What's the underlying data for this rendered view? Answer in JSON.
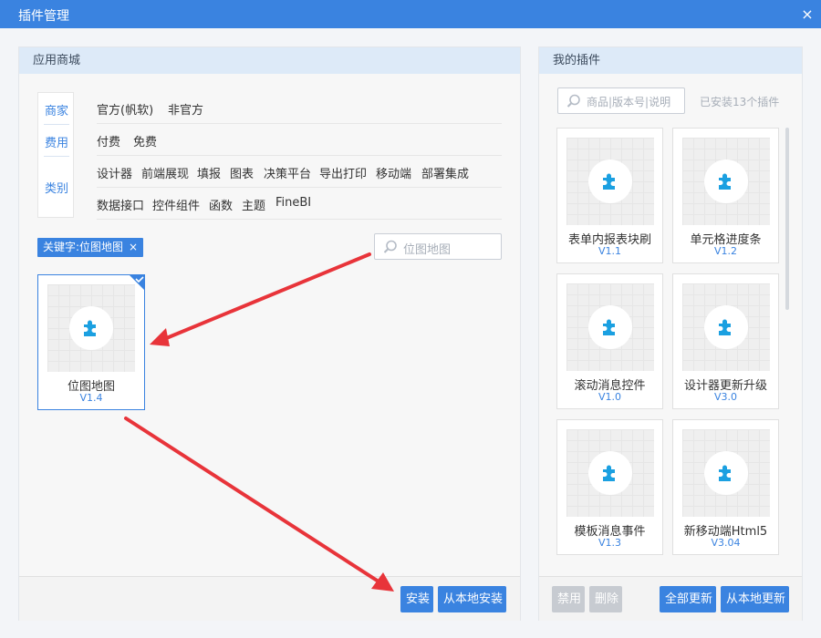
{
  "window": {
    "title": "插件管理",
    "close_glyph": "×"
  },
  "left_panel": {
    "header": "应用商城",
    "filter_tabs": [
      "商家",
      "费用",
      "类别"
    ],
    "merchant_options": [
      "官方(帆软)",
      "非官方"
    ],
    "fee_options": [
      "付费",
      "免费"
    ],
    "category_options_row1": [
      "设计器",
      "前端展现",
      "填报",
      "图表",
      "决策平台",
      "导出打印",
      "移动端",
      "部署集成"
    ],
    "category_options_row2": [
      "数据接口",
      "控件组件",
      "函数",
      "主题",
      "FineBI"
    ],
    "keyword_tag": {
      "label": "关键字:位图地图",
      "remove_glyph": "×"
    },
    "search": {
      "placeholder": "位图地图",
      "icon": "search-icon"
    },
    "results": [
      {
        "name": "位图地图",
        "version": "V1.4",
        "selected": true
      }
    ],
    "footer": {
      "install_label": "安装",
      "install_local_label": "从本地安装"
    }
  },
  "right_panel": {
    "header": "我的插件",
    "search": {
      "placeholder": "商品|版本号|说明",
      "icon": "search-icon"
    },
    "installed_count": "已安装13个插件",
    "plugins": [
      {
        "name": "表单内报表块刷",
        "version": "V1.1"
      },
      {
        "name": "单元格进度条",
        "version": "V1.2"
      },
      {
        "name": "滚动消息控件",
        "version": "V1.0"
      },
      {
        "name": "设计器更新升级",
        "version": "V3.0"
      },
      {
        "name": "模板消息事件",
        "version": "V1.3"
      },
      {
        "name": "新移动端Html5",
        "version": "V3.04"
      }
    ],
    "footer": {
      "disable_label": "禁用",
      "delete_label": "删除",
      "update_all_label": "全部更新",
      "update_local_label": "从本地更新"
    }
  },
  "colors": {
    "accent": "#3a83e0",
    "arrow": "#e8343a",
    "header_bg": "#ddeaf8",
    "plugin_icon": "#1ba0e1"
  }
}
